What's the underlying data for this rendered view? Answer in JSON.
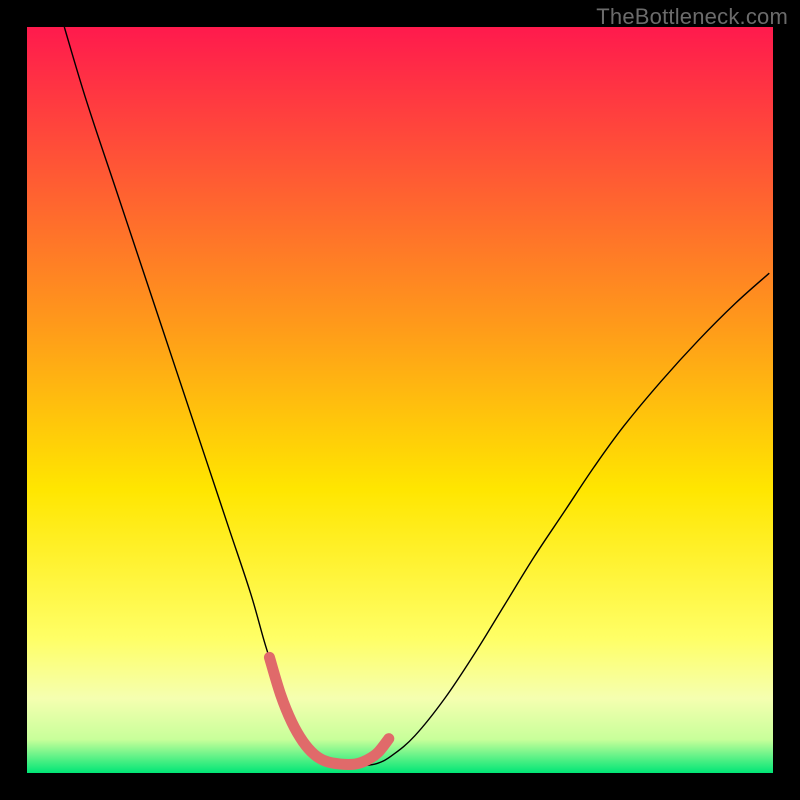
{
  "watermark": "TheBottleneck.com",
  "chart_data": {
    "type": "line",
    "title": "",
    "xlabel": "",
    "ylabel": "",
    "xlim": [
      0,
      100
    ],
    "ylim": [
      0,
      100
    ],
    "grid": false,
    "legend": false,
    "background_gradient": {
      "stops": [
        {
          "offset": 0.0,
          "color": "#ff1a4d"
        },
        {
          "offset": 0.4,
          "color": "#ff9a1a"
        },
        {
          "offset": 0.62,
          "color": "#ffe600"
        },
        {
          "offset": 0.82,
          "color": "#ffff66"
        },
        {
          "offset": 0.9,
          "color": "#f5ffb0"
        },
        {
          "offset": 0.955,
          "color": "#c8ff9a"
        },
        {
          "offset": 1.0,
          "color": "#00e676"
        }
      ]
    },
    "series": [
      {
        "name": "curve",
        "color": "#000000",
        "width": 1.4,
        "x": [
          5,
          8,
          12,
          16,
          20,
          24,
          27,
          30,
          32,
          34,
          35.5,
          37,
          38.5,
          40,
          42,
          45,
          47,
          49,
          52,
          56,
          60,
          64,
          68,
          72,
          76,
          80,
          85,
          90,
          95,
          99.5
        ],
        "y": [
          100,
          90,
          78,
          66,
          54,
          42,
          33,
          24,
          17,
          11,
          7,
          4,
          2.2,
          1.3,
          1.0,
          1.0,
          1.3,
          2.4,
          5,
          10,
          16,
          22.5,
          29,
          35,
          41,
          46.5,
          52.5,
          58,
          63,
          67
        ]
      },
      {
        "name": "highlight",
        "color": "#e06a6a",
        "width": 11,
        "linecap": "round",
        "x": [
          32.5,
          34,
          35.5,
          37,
          38.5,
          40,
          42,
          44,
          45.5,
          47,
          48.5
        ],
        "y": [
          15.5,
          10.5,
          6.8,
          4.2,
          2.5,
          1.6,
          1.2,
          1.2,
          1.7,
          2.7,
          4.6
        ]
      }
    ]
  }
}
